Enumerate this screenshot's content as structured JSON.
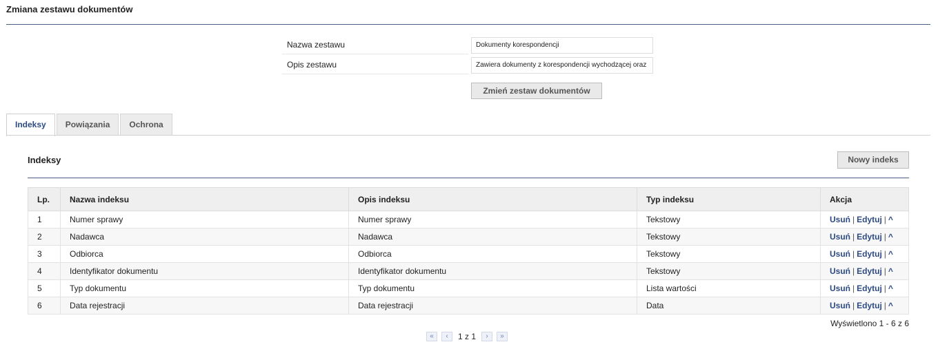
{
  "page": {
    "title": "Zmiana zestawu dokumentów"
  },
  "form": {
    "name_label": "Nazwa zestawu",
    "name_value": "Dokumenty korespondencji",
    "desc_label": "Opis zestawu",
    "desc_value": "Zawiera dokumenty z korespondencji wychodzącej oraz przychodzącej",
    "submit_label": "Zmień zestaw dokumentów"
  },
  "tabs": [
    {
      "label": "Indeksy",
      "active": true
    },
    {
      "label": "Powiązania",
      "active": false
    },
    {
      "label": "Ochrona",
      "active": false
    }
  ],
  "section": {
    "title": "Indeksy",
    "new_button": "Nowy indeks"
  },
  "table": {
    "headers": [
      "Lp.",
      "Nazwa indeksu",
      "Opis indeksu",
      "Typ indeksu",
      "Akcja"
    ],
    "rows": [
      {
        "lp": "1",
        "name": "Numer sprawy",
        "desc": "Numer sprawy",
        "type": "Tekstowy"
      },
      {
        "lp": "2",
        "name": "Nadawca",
        "desc": "Nadawca",
        "type": "Tekstowy"
      },
      {
        "lp": "3",
        "name": "Odbiorca",
        "desc": "Odbiorca",
        "type": "Tekstowy"
      },
      {
        "lp": "4",
        "name": "Identyfikator dokumentu",
        "desc": "Identyfikator dokumentu",
        "type": "Tekstowy"
      },
      {
        "lp": "5",
        "name": "Typ dokumentu",
        "desc": "Typ dokumentu",
        "type": "Lista wartości"
      },
      {
        "lp": "6",
        "name": "Data rejestracji",
        "desc": "Data rejestracji",
        "type": "Data"
      }
    ],
    "actions": {
      "delete": "Usuń",
      "edit": "Edytuj",
      "sep": "|",
      "up": "^"
    }
  },
  "summary": "Wyświetlono 1 - 6 z 6",
  "pager": {
    "text": "1 z 1",
    "first": "«",
    "prev": "‹",
    "next": "›",
    "last": "»"
  }
}
